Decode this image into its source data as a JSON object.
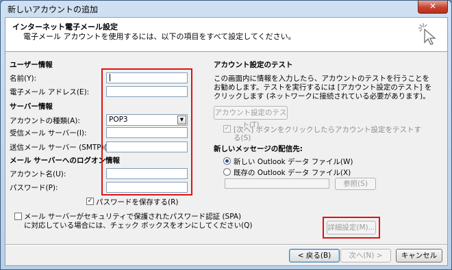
{
  "window": {
    "title": "新しいアカウントの追加",
    "close_label": "✕"
  },
  "header": {
    "title": "インターネット電子メール設定",
    "subtitle": "電子メール アカウントを使用するには、以下の項目をすべて設定してください。",
    "icon": "cursor-sparkle-icon"
  },
  "user_info": {
    "heading": "ユーザー情報",
    "name_label": "名前(Y):",
    "name_value": "",
    "email_label": "電子メール アドレス(E):",
    "email_value": ""
  },
  "server_info": {
    "heading": "サーバー情報",
    "account_type_label": "アカウントの種類(A):",
    "account_type_value": "POP3",
    "incoming_label": "受信メール サーバー(I):",
    "incoming_value": "",
    "outgoing_label": "送信メール サーバー (SMTP)(O):",
    "outgoing_value": ""
  },
  "logon_info": {
    "heading": "メール サーバーへのログオン情報",
    "account_name_label": "アカウント名(U):",
    "account_name_value": "",
    "password_label": "パスワード(P):",
    "password_value": "",
    "remember_password_label": "パスワードを保存する(R)",
    "remember_password_checked": true,
    "spa_label_line1": "メール サーバーがセキュリティで保護されたパスワード認証 (SPA)",
    "spa_label_line2": "に対応している場合には、チェック ボックスをオンにしてください(Q)",
    "spa_checked": false
  },
  "test": {
    "heading": "アカウント設定のテスト",
    "desc_line1": "この画面内に情報を入力したら、アカウントのテストを行うことを",
    "desc_line2": "お勧めします。テストを実行するには [アカウント設定のテスト] を",
    "desc_line3": "クリックします (ネットワークに接続されている必要があります)。",
    "test_button": "アカウント設定のテスト(T)",
    "auto_test_line1": "[次へ] ボタンをクリックしたらアカウント設定をテストす",
    "auto_test_line2": "る(S)",
    "auto_test_checked": true
  },
  "delivery": {
    "heading": "新しいメッセージの配信先:",
    "option_new": "新しい Outlook データ ファイル(W)",
    "option_existing": "既存の Outlook データ ファイル(X)",
    "selected": "new",
    "existing_path": "",
    "browse_button": "参照(S)"
  },
  "more_settings_button": "詳細設定(M)...",
  "footer": {
    "back_button": "< 戻る(B)",
    "next_button": "次へ(N) >",
    "cancel_button": "キャンセル"
  },
  "colors": {
    "highlight_border": "#e01010",
    "title_gradient": "#cfe0f2"
  }
}
